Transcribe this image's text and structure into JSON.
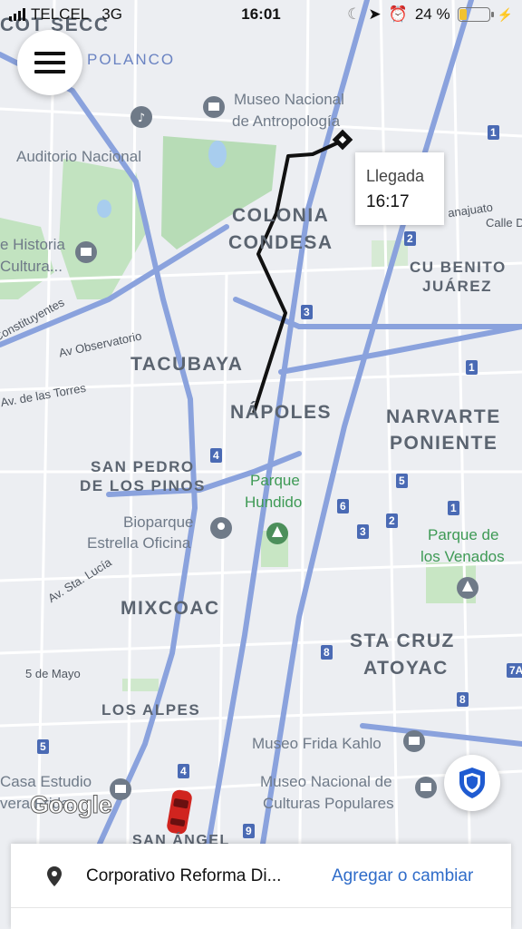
{
  "status_bar": {
    "carrier": "TELCEL",
    "network": "3G",
    "time": "16:01",
    "battery": "24 %",
    "battery_level": 0.24
  },
  "map": {
    "areas": [
      "COLONIA",
      "CONDESA",
      "TACUBAYA",
      "NÁPOLES",
      "NARVARTE",
      "PONIENTE",
      "SAN PEDRO",
      "DE LOS PINOS",
      "MIXCOAC",
      "STA CRUZ",
      "ATOYAC",
      "LOS ALPES",
      "CU BENITO",
      "JUÁREZ",
      "POLANCO",
      "COT SECC"
    ],
    "places": [
      "Museo Nacional",
      "de Antropología",
      "Auditorio Nacional",
      "e Historia",
      "Cultura...",
      "Bioparque",
      "Estrella Oficina",
      "Museo Frida Kahlo",
      "Museo Nacional de",
      "Culturas Populares",
      "Casa Estudio",
      "vera Frida..."
    ],
    "parks": [
      "Parque",
      "Hundido",
      "Parque de",
      "los Venados"
    ],
    "streets": [
      "Constituyentes",
      "Av Observatorio",
      "Av. de las Torres",
      "Av. Sta. Lucía",
      "5 de Mayo",
      "Calle D",
      "anajuato",
      "SAN ÁNGEL"
    ],
    "road_numbers": [
      "1",
      "2",
      "3",
      "4",
      "5",
      "6",
      "8",
      "9",
      "7A"
    ],
    "google_logo": "Google"
  },
  "eta_box": {
    "label": "Llegada",
    "time": "16:17"
  },
  "bottom_sheet": {
    "destination": "Corporativo Reforma Di...",
    "action": "Agregar o cambiar"
  },
  "icons": [
    "menu-icon",
    "shield-icon",
    "location-pin-icon",
    "car-icon",
    "destination-marker-icon",
    "museum-icon",
    "music-icon",
    "park-icon",
    "location-arrow-icon",
    "alarm-icon",
    "moon-icon",
    "charging-icon"
  ],
  "colors": {
    "route": "#111111",
    "major_road": "#8aa2dd",
    "park": "#b7dcb6",
    "link": "#2f6cc9",
    "car": "#d0241f",
    "shield": "#1f5bd1"
  }
}
